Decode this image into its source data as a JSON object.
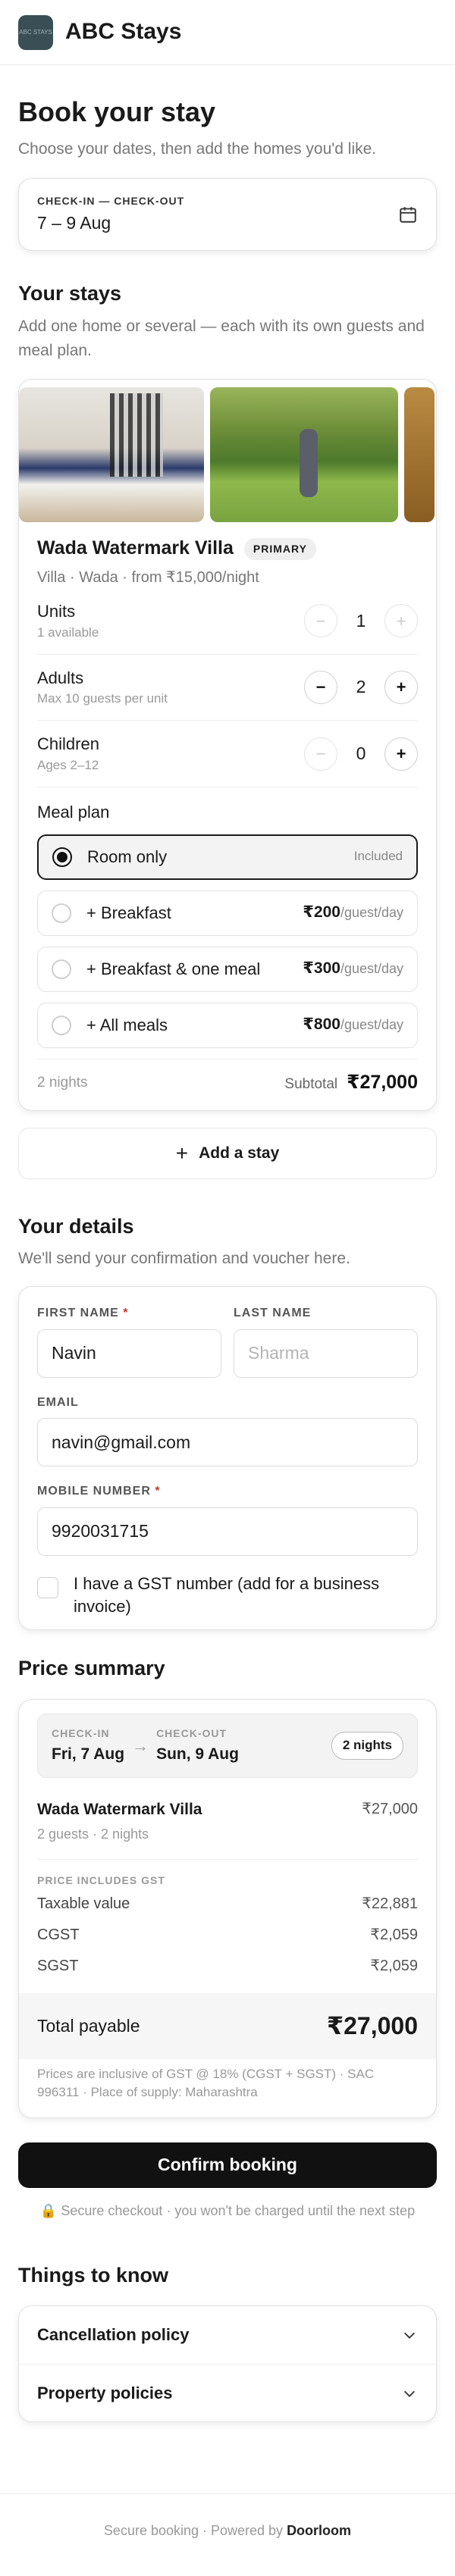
{
  "header": {
    "logo_text": "ABC STAYS",
    "brand": "ABC Stays"
  },
  "page": {
    "title": "Book your stay",
    "subtitle": "Choose your dates, then add the homes you'd like."
  },
  "dates": {
    "label": "CHECK-IN — CHECK-OUT",
    "value": "7 – 9 Aug",
    "icon": "calendar-icon"
  },
  "stays_section": {
    "title": "Your stays",
    "subtitle": "Add one home or several — each with its own guests and meal plan."
  },
  "stay": {
    "name": "Wada Watermark Villa",
    "badge": "PRIMARY",
    "meta": "Villa · Wada · from ₹15,000/night",
    "rows": [
      {
        "label": "Units",
        "hint": "1 available",
        "value": "1",
        "minus_enabled": false,
        "plus_enabled": false
      },
      {
        "label": "Adults",
        "hint": "Max 10 guests per unit",
        "value": "2",
        "minus_enabled": true,
        "plus_enabled": true
      },
      {
        "label": "Children",
        "hint": "Ages 2–12",
        "value": "0",
        "minus_enabled": false,
        "plus_enabled": true
      }
    ],
    "meal_title": "Meal plan",
    "meals": [
      {
        "label": "Room only",
        "price": "",
        "unit": "",
        "note": "Included",
        "selected": true
      },
      {
        "label": "+ Breakfast",
        "price": "₹200",
        "unit": "/guest/day",
        "note": "",
        "selected": false
      },
      {
        "label": "+ Breakfast & one meal",
        "price": "₹300",
        "unit": "/guest/day",
        "note": "",
        "selected": false
      },
      {
        "label": "+ All meals",
        "price": "₹800",
        "unit": "/guest/day",
        "note": "",
        "selected": false
      }
    ],
    "nights": "2 nights",
    "subtotal_label": "Subtotal",
    "subtotal_value": "₹27,000"
  },
  "add_stay_label": "Add a stay",
  "details": {
    "title": "Your details",
    "subtitle": "We'll send your confirmation and voucher here.",
    "first_name_label": "FIRST NAME",
    "first_name_value": "Navin",
    "last_name_label": "LAST NAME",
    "last_name_placeholder": "Sharma",
    "email_label": "EMAIL",
    "email_value": "navin@gmail.com",
    "mobile_label": "MOBILE NUMBER",
    "mobile_value": "9920031715",
    "gst_label": "I have a GST number (add for a business invoice)"
  },
  "price_summary": {
    "title": "Price summary",
    "checkin_label": "CHECK-IN",
    "checkin_value": "Fri, 7 Aug",
    "checkout_label": "CHECK-OUT",
    "checkout_value": "Sun, 9 Aug",
    "nights_badge": "2 nights",
    "item_name": "Wada Watermark Villa",
    "item_value": "₹27,000",
    "item_meta": "2 guests · 2 nights",
    "gst_heading": "PRICE INCLUDES GST",
    "lines": [
      {
        "label": "Taxable value",
        "value": "₹22,881"
      },
      {
        "label": "CGST",
        "value": "₹2,059"
      },
      {
        "label": "SGST",
        "value": "₹2,059"
      }
    ],
    "total_label": "Total payable",
    "total_value": "₹27,000",
    "note": "Prices are inclusive of GST @ 18% (CGST + SGST) · SAC 996311 · Place of supply: Maharashtra"
  },
  "confirm_label": "Confirm booking",
  "secure_note": "Secure checkout · you won't be charged until the next step",
  "things": {
    "title": "Things to know",
    "items": [
      "Cancellation policy",
      "Property policies"
    ]
  },
  "footer": {
    "prefix": "Secure booking · Powered by ",
    "brand": "Doorloom"
  }
}
